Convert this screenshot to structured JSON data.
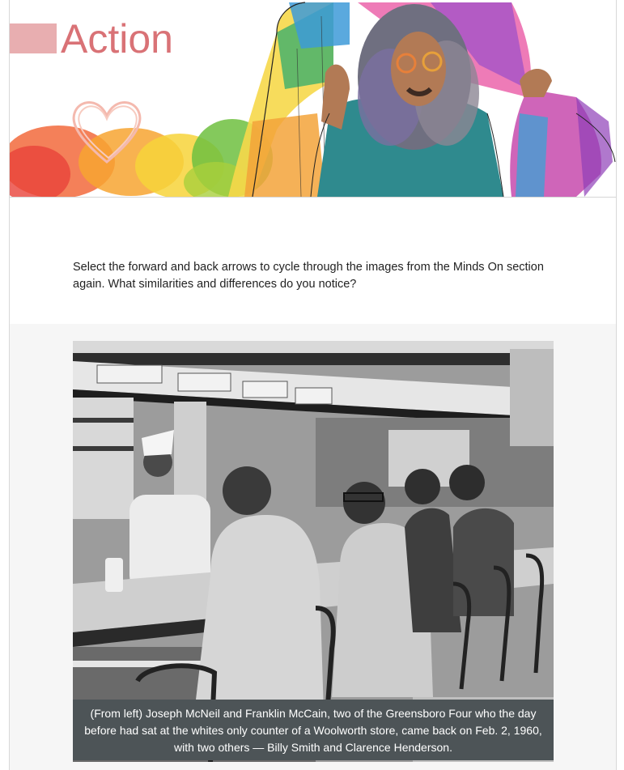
{
  "banner": {
    "title": "Action",
    "colors": {
      "title": "#d97276",
      "accent_block": "#e8aeb0"
    },
    "illustration": "person-with-rainbow-pride-flag",
    "decoration": "heart-icon"
  },
  "instructions": {
    "text": "Select the forward and back arrows to cycle through the images from the Minds On section again. What similarities and differences do you notice?"
  },
  "gallery": {
    "image": "greensboro-lunch-counter-photo",
    "caption": "(From left) Joseph McNeil and Franklin McCain, two of the Greensboro Four who the day before had sat at the whites only counter of a Woolworth store, came back on Feb. 2, 1960, with two others — Billy Smith and Clarence Henderson.",
    "colors": {
      "caption_bg": "#4d5457",
      "caption_text": "#ffffff"
    }
  }
}
